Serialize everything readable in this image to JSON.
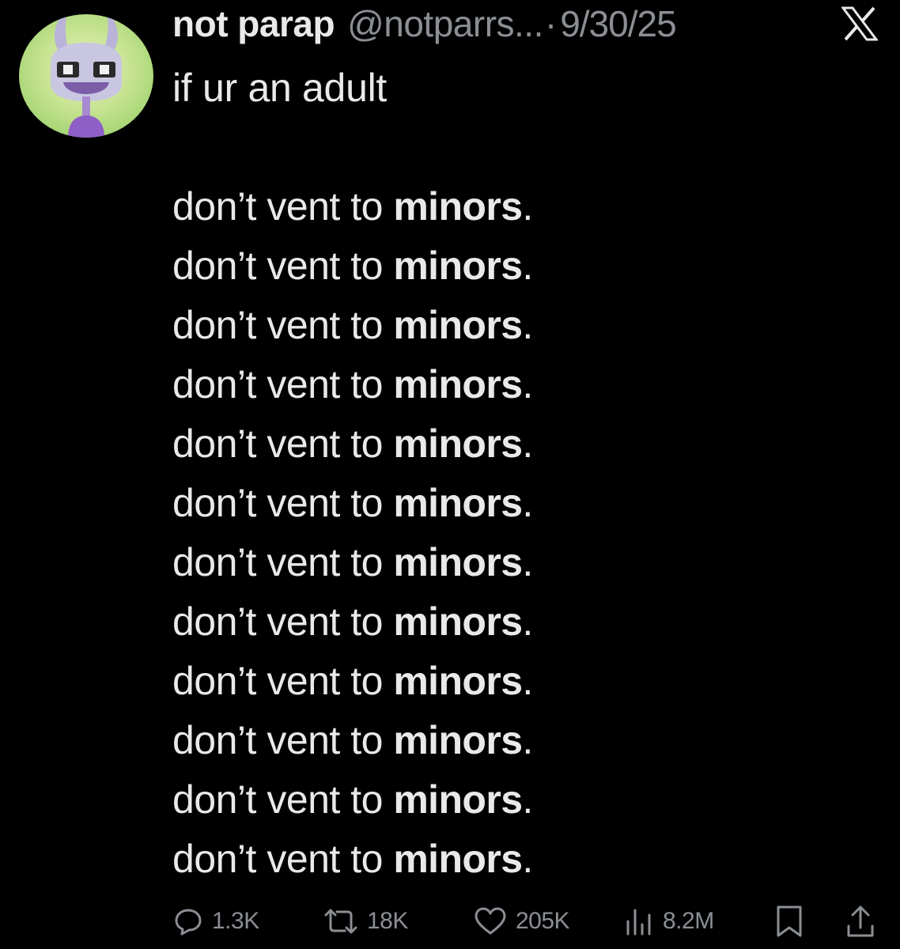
{
  "post": {
    "author": {
      "display_name": "not parap",
      "handle": "@notparrs...",
      "separator": "·",
      "date": "9/30/25"
    },
    "platform_icon": "x-logo-icon",
    "avatar_icon": "cartoon-character-avatar",
    "text": {
      "intro": "if ur an adult",
      "lines": [
        {
          "prefix": "don’t vent to ",
          "emphasis": "minors",
          "suffix": "."
        },
        {
          "prefix": "don’t vent to ",
          "emphasis": "minors",
          "suffix": "."
        },
        {
          "prefix": "don’t vent to ",
          "emphasis": "minors",
          "suffix": "."
        },
        {
          "prefix": "don’t vent to ",
          "emphasis": "minors",
          "suffix": "."
        },
        {
          "prefix": "don’t vent to ",
          "emphasis": "minors",
          "suffix": "."
        },
        {
          "prefix": "don’t vent to ",
          "emphasis": "minors",
          "suffix": "."
        },
        {
          "prefix": "don’t vent to ",
          "emphasis": "minors",
          "suffix": "."
        },
        {
          "prefix": "don’t vent to ",
          "emphasis": "minors",
          "suffix": "."
        },
        {
          "prefix": "don’t vent to ",
          "emphasis": "minors",
          "suffix": "."
        },
        {
          "prefix": "don’t vent to ",
          "emphasis": "minors",
          "suffix": "."
        },
        {
          "prefix": "don’t vent to ",
          "emphasis": "minors",
          "suffix": "."
        },
        {
          "prefix": "don’t vent to ",
          "emphasis": "minors",
          "suffix": "."
        }
      ]
    },
    "actions": {
      "replies": {
        "icon": "reply-icon",
        "count": "1.3K"
      },
      "reposts": {
        "icon": "repost-icon",
        "count": "18K"
      },
      "likes": {
        "icon": "heart-icon",
        "count": "205K"
      },
      "views": {
        "icon": "views-chart-icon",
        "count": "8.2M"
      },
      "bookmark": {
        "icon": "bookmark-icon"
      },
      "share": {
        "icon": "share-icon"
      }
    }
  },
  "colors": {
    "background": "#000000",
    "primary_text": "#e7e9ea",
    "secondary_text": "#8b8f94"
  }
}
